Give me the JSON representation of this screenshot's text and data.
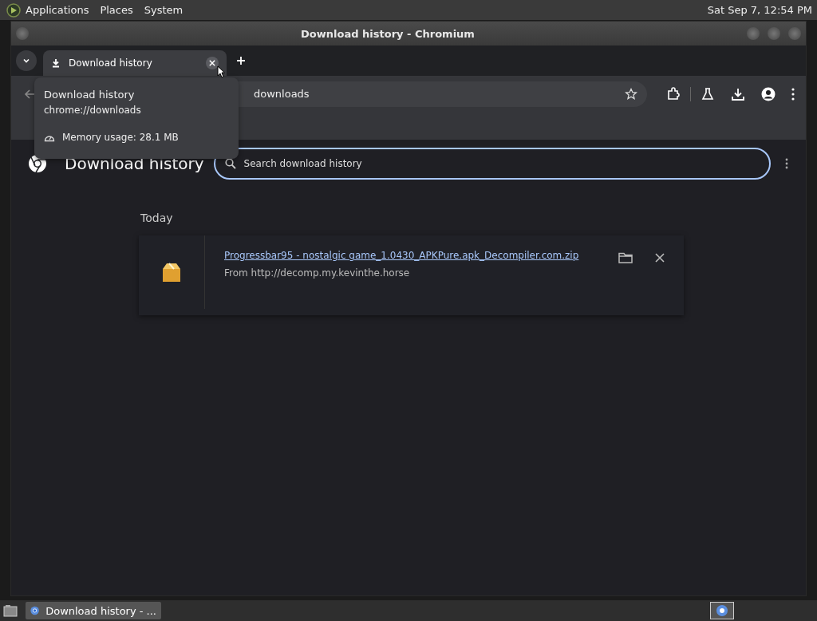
{
  "top_panel": {
    "menus": [
      "Applications",
      "Places",
      "System"
    ],
    "clock": "Sat Sep  7, 12:54 PM"
  },
  "window": {
    "title": "Download history - Chromium"
  },
  "tabs": [
    {
      "label": "Download history",
      "selected": true
    }
  ],
  "address_bar": {
    "value": "downloads"
  },
  "tab_tooltip": {
    "title": "Download history",
    "url": "chrome://downloads",
    "memory": "Memory usage: 28.1 MB"
  },
  "page": {
    "heading": "Download history",
    "search": {
      "placeholder": "Search download history"
    },
    "section": "Today",
    "downloads": [
      {
        "filename": "Progressbar95 - nostalgic game_1.0430_APKPure.apk_Decompiler.com.zip",
        "source": "From http://decomp.my.kevinthe.horse"
      }
    ]
  },
  "taskbar": {
    "items": [
      {
        "label": "Download history - ...",
        "selected": true
      }
    ]
  }
}
